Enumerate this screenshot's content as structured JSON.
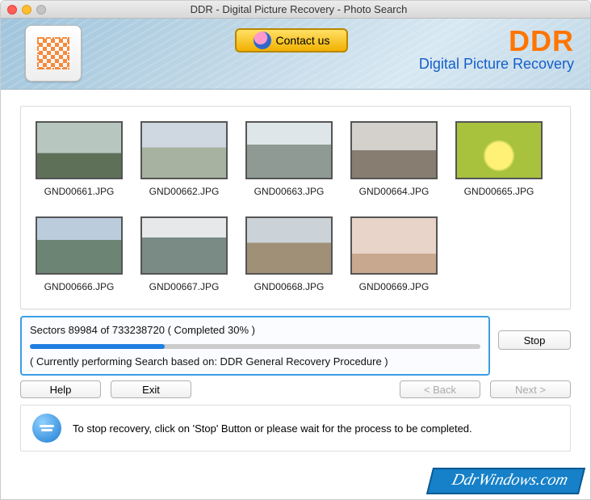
{
  "window": {
    "title": "DDR - Digital Picture Recovery - Photo Search"
  },
  "header": {
    "contact_label": "Contact us",
    "brand_top": "DDR",
    "brand_bottom": "Digital Picture Recovery"
  },
  "thumbnails": [
    {
      "label": "GND00661.JPG"
    },
    {
      "label": "GND00662.JPG"
    },
    {
      "label": "GND00663.JPG"
    },
    {
      "label": "GND00664.JPG"
    },
    {
      "label": "GND00665.JPG"
    },
    {
      "label": "GND00666.JPG"
    },
    {
      "label": "GND00667.JPG"
    },
    {
      "label": "GND00668.JPG"
    },
    {
      "label": "GND00669.JPG"
    }
  ],
  "progress": {
    "sectors_line": "Sectors 89984 of 733238720   ( Completed 30% )",
    "percent": 30,
    "method_line": "( Currently performing Search based on: DDR General Recovery Procedure )"
  },
  "buttons": {
    "stop": "Stop",
    "help": "Help",
    "exit": "Exit",
    "back": "< Back",
    "next": "Next >"
  },
  "info": {
    "text": "To stop recovery, click on 'Stop' Button or please wait for the process to be completed."
  },
  "watermark": "DdrWindows.com"
}
